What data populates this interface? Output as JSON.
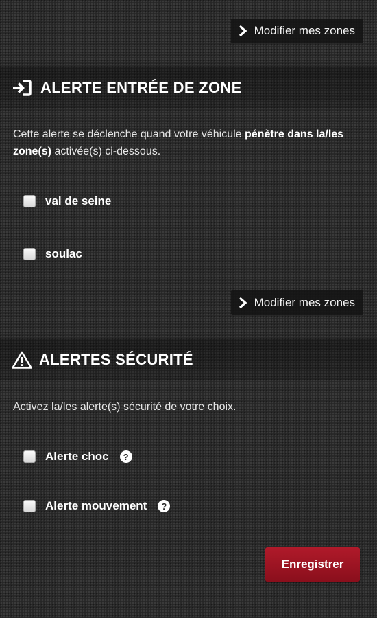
{
  "zone_link": {
    "label": "Modifier mes zones",
    "icon": "chevron-right-icon"
  },
  "zone_entry": {
    "title": "ALERTE ENTRÉE DE ZONE",
    "icon": "sign-in-icon",
    "desc_part1": "Cette alerte se déclenche quand votre véhicule ",
    "desc_bold": "pénètre dans la/les zone(s)",
    "desc_part2": " activée(s) ci-dessous.",
    "zones": [
      {
        "label": "val de seine",
        "checked": false
      },
      {
        "label": "soulac",
        "checked": false
      }
    ]
  },
  "security": {
    "title": "ALERTES SÉCURITÉ",
    "icon": "warning-triangle-icon",
    "desc": "Activez la/les alerte(s) sécurité de votre choix.",
    "alerts": [
      {
        "label": "Alerte choc",
        "checked": false,
        "help": "?"
      },
      {
        "label": "Alerte mouvement",
        "checked": false,
        "help": "?"
      }
    ]
  },
  "save_button": {
    "label": "Enregistrer",
    "color": "#a3142a"
  }
}
